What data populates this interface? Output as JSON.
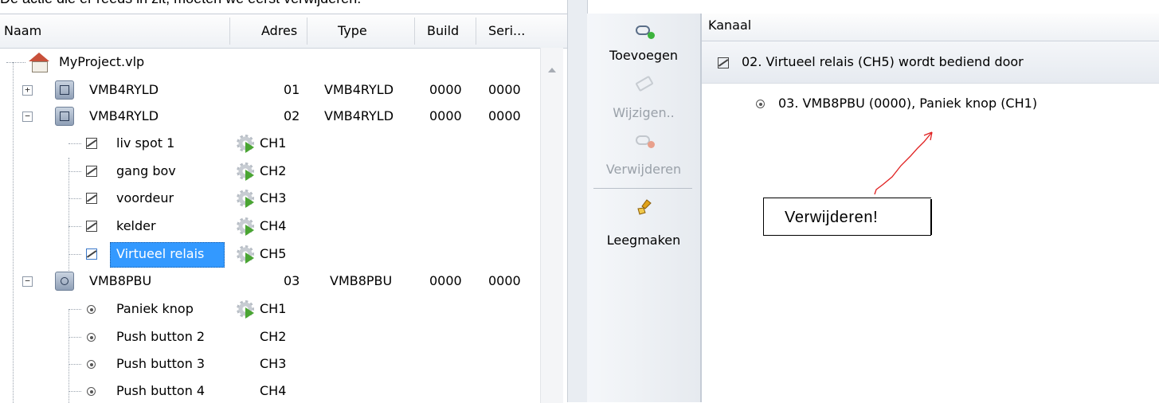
{
  "caption": "De actie die er reeds in zit, moeten we eerst verwijderen.",
  "tree": {
    "columns": [
      "Naam",
      "Adres",
      "Type",
      "Build",
      "Seri..."
    ],
    "root": "MyProject.vlp",
    "modules": [
      {
        "name": "VMB4RYLD",
        "adres": "01",
        "type": "VMB4RYLD",
        "build": "0000",
        "serial": "0000",
        "expander": "+"
      },
      {
        "name": "VMB4RYLD",
        "adres": "02",
        "type": "VMB4RYLD",
        "build": "0000",
        "serial": "0000",
        "expander": "−"
      },
      {
        "name": "VMB8PBU",
        "adres": "03",
        "type": "VMB8PBU",
        "build": "0000",
        "serial": "0000",
        "expander": "−"
      }
    ],
    "channels_relay": [
      {
        "name": "liv spot 1",
        "ch": "CH1"
      },
      {
        "name": "gang bov",
        "ch": "CH2"
      },
      {
        "name": "voordeur",
        "ch": "CH3"
      },
      {
        "name": "kelder",
        "ch": "CH4"
      },
      {
        "name": "Virtueel relais",
        "ch": "CH5",
        "selected": true
      }
    ],
    "channels_pbu": [
      {
        "name": "Paniek knop",
        "ch": "CH1"
      },
      {
        "name": "Push button 2",
        "ch": "CH2"
      },
      {
        "name": "Push button 3",
        "ch": "CH3"
      },
      {
        "name": "Push button 4",
        "ch": "CH4"
      }
    ]
  },
  "toolbar": {
    "add": "Toevoegen",
    "edit": "Wijzigen..",
    "remove": "Verwijderen",
    "clear": "Leegmaken"
  },
  "right": {
    "header": "Kanaal",
    "target": "02. Virtueel relais (CH5) wordt bediend door",
    "source": "03. VMB8PBU (0000), Paniek knop (CH1)"
  },
  "annotation": {
    "label": "Verwijderen!",
    "arrow_color": "#e02020"
  }
}
